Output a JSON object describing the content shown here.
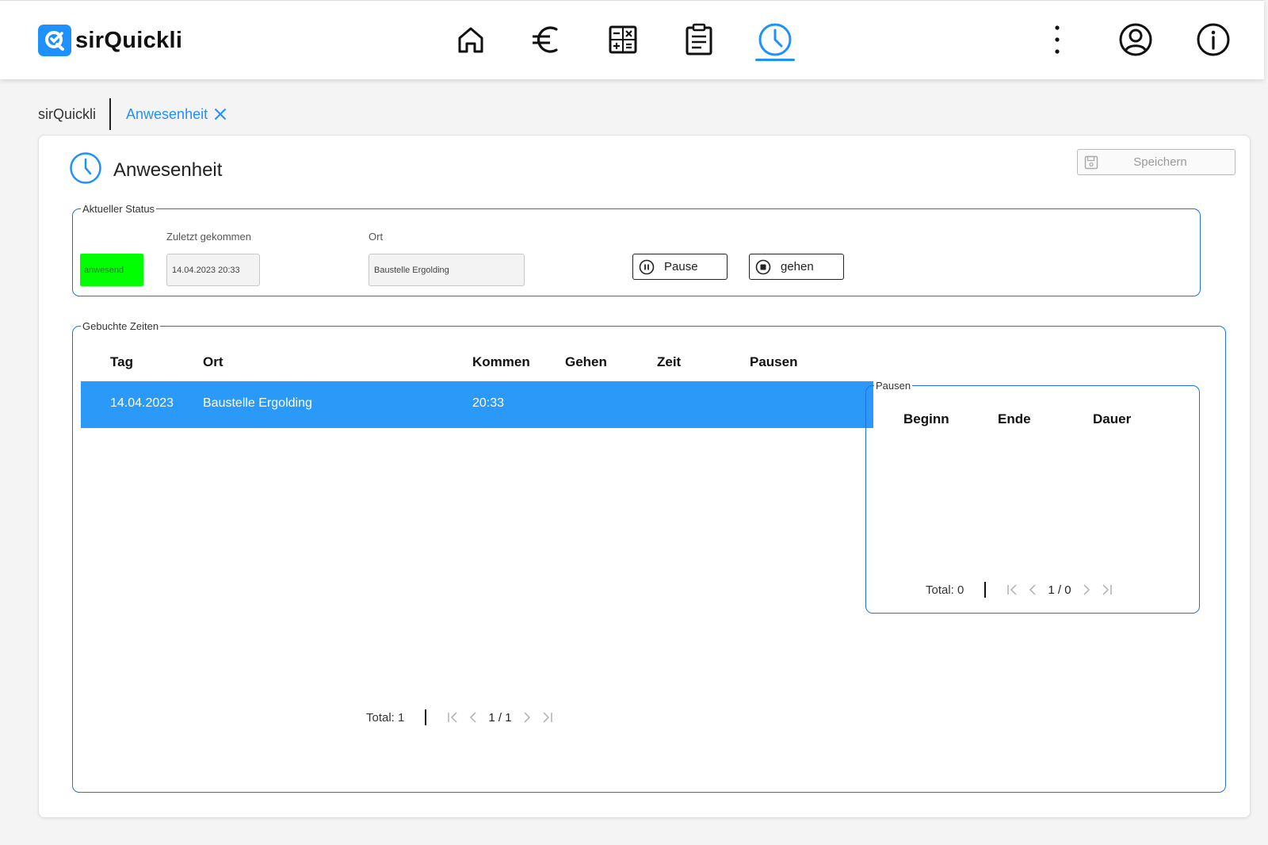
{
  "app": {
    "logo_text": "sirQuickli"
  },
  "nav": {
    "icons": [
      "home-icon",
      "euro-icon",
      "calculator-icon",
      "clipboard-icon",
      "clock-icon",
      "more-vertical-icon",
      "user-account-icon",
      "info-icon"
    ],
    "active": "clock-icon"
  },
  "breadcrumb": {
    "home": "sirQuickli",
    "active": "Anwesenheit"
  },
  "page": {
    "title": "Anwesenheit",
    "save_label": "Speichern"
  },
  "status": {
    "legend": "Aktueller Status",
    "badge": "anwesend",
    "last_came_label": "Zuletzt gekommen",
    "last_came_value": "14.04.2023 20:33",
    "location_label": "Ort",
    "location_value": "Baustelle Ergolding",
    "pause_label": "Pause",
    "leave_label": "gehen"
  },
  "times": {
    "legend": "Gebuchte Zeiten",
    "columns": [
      "Tag",
      "Ort",
      "Kommen",
      "Gehen",
      "Zeit",
      "Pausen"
    ],
    "rows": [
      {
        "tag": "14.04.2023",
        "ort": "Baustelle Ergolding",
        "kommen": "20:33",
        "gehen": "",
        "zeit": "",
        "pausen": ""
      }
    ],
    "total": "Total: 1",
    "page": "1 / 1"
  },
  "pausen": {
    "legend": "Pausen",
    "columns": [
      "Beginn",
      "Ende",
      "Dauer"
    ],
    "total": "Total: 0",
    "page": "1 / 0"
  },
  "colors": {
    "accent": "#1e90ff",
    "selected_row": "#2b99f7",
    "status_green": "#00ff00"
  }
}
